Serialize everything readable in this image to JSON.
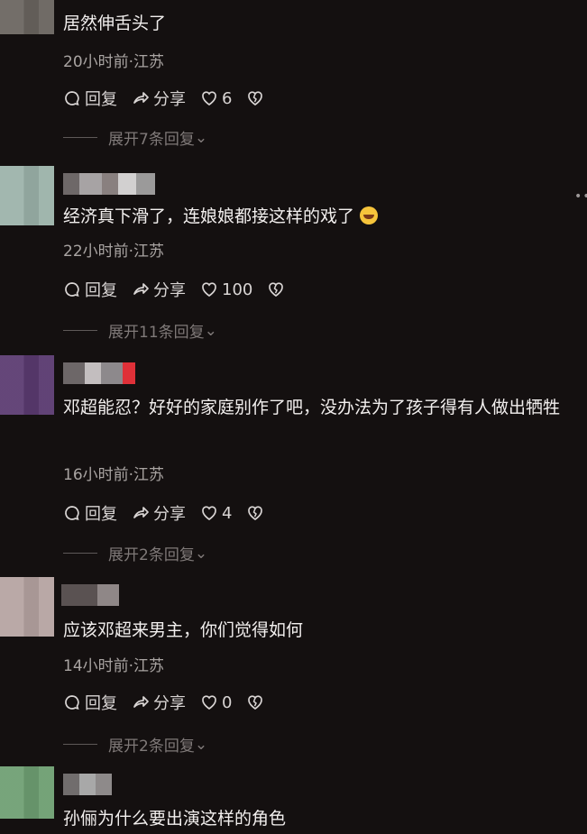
{
  "comments": [
    {
      "text": "居然伸舌头了",
      "meta": "20小时前·江苏",
      "reply": "回复",
      "share": "分享",
      "likes": "6",
      "expand": "展开7条回复",
      "avatar_color": "#69635f",
      "nick_colors": [
        "#ffffff20",
        "#ffffff30",
        "#ffffff15"
      ]
    },
    {
      "text": "经济真下滑了，连娘娘都接这样的戏了",
      "meta": "22小时前·江苏",
      "reply": "回复",
      "share": "分享",
      "likes": "100",
      "expand": "展开11条回复",
      "avatar_color": "#9bb2a8",
      "nick_colors": [
        "#706a6a",
        "#a6a3a4",
        "#89807f",
        "#c9c9c9"
      ]
    },
    {
      "text": "邓超能忍？好好的家庭别作了吧，没办法为了孩子得有人做出牺牲",
      "meta": "16小时前·江苏",
      "reply": "回复",
      "share": "分享",
      "likes": "4",
      "expand": "展开2条回复",
      "avatar_color": "#5c3e71",
      "nick_colors": [
        "#6d6768",
        "#c3bebf",
        "#8d898c",
        "#de2f37"
      ]
    },
    {
      "text": "应该邓超来男主，你们觉得如何",
      "meta": "14小时前·江苏",
      "reply": "回复",
      "share": "分享",
      "likes": "0",
      "expand": "展开2条回复",
      "avatar_color": "#b4a3a1",
      "nick_colors": [
        "#5a5252",
        "#8f8787"
      ]
    },
    {
      "text": "孙俪为什么要出演这样的角色",
      "meta": "",
      "reply": "",
      "share": "",
      "likes": "",
      "expand": "",
      "avatar_color": "#6e9d72",
      "nick_colors": [
        "#716d6d",
        "#a8a8a8",
        "#8e8a8a"
      ]
    }
  ]
}
